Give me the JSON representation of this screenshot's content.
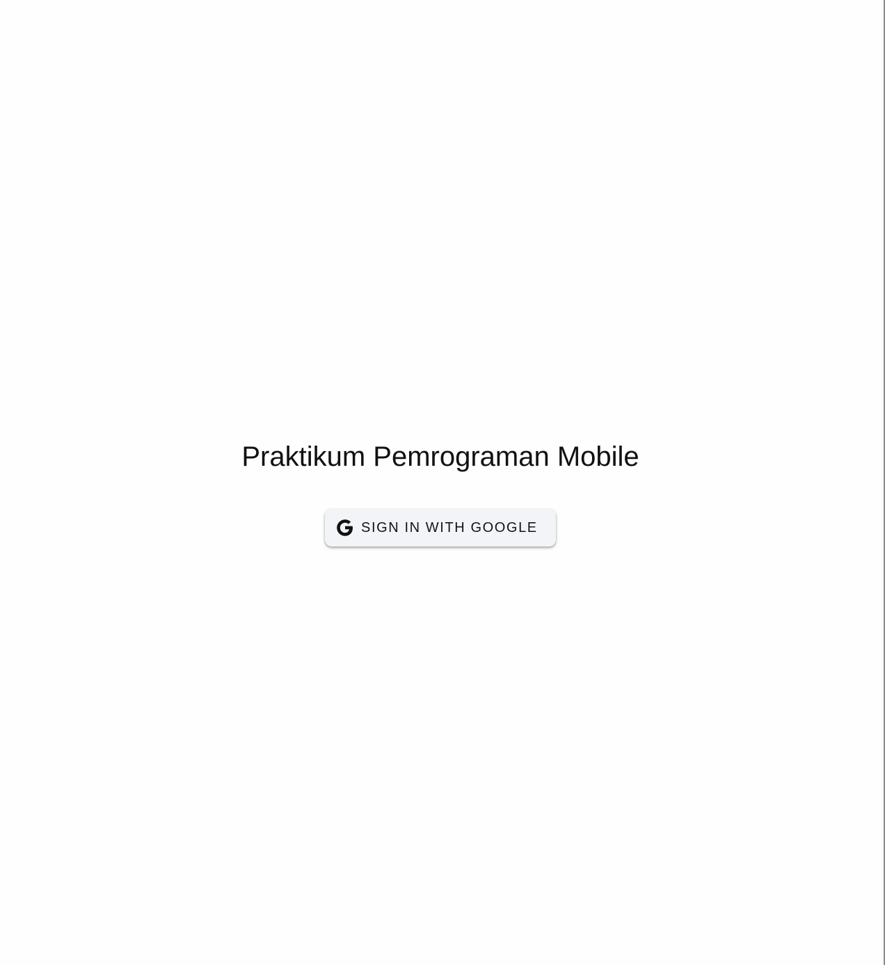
{
  "page": {
    "title": "Praktikum Pemrograman Mobile"
  },
  "signin": {
    "label": "SIGN IN WITH GOOGLE",
    "icon": "google-g-icon"
  },
  "colors": {
    "background": "#fefefe",
    "button_bg": "#f3f4f8",
    "text": "#111111"
  }
}
